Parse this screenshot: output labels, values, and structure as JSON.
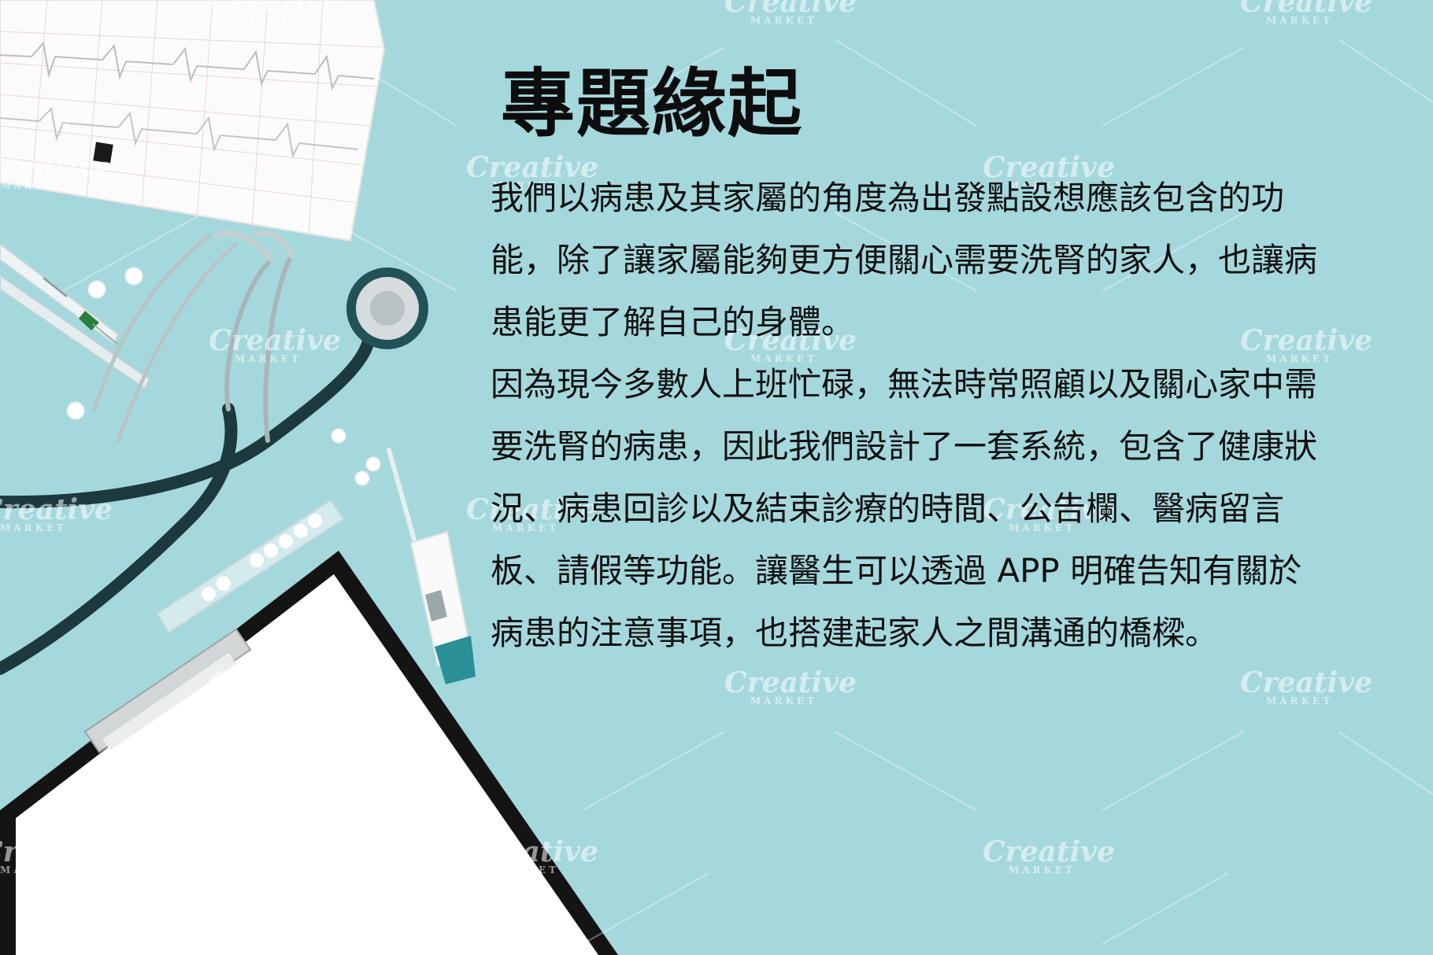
{
  "slide": {
    "title": "專題緣起",
    "lines": [
      " 我們以病患及其家屬的角度為出發點設想應該包含的功",
      "能，除了讓家屬能夠更方便關心需要洗腎的家人，也讓病",
      "患能更了解自己的身體。",
      "因為現今多數人上班忙碌，無法時常照顧以及關心家中需",
      "要洗腎的病患，因此我們設計了一套系統，包含了健康狀",
      "況、病患回診以及結束診療的時間、公告欄、醫病留言",
      "板、請假等功能。讓醫生可以透過 APP 明確告知有關於",
      "病患的注意事項，也搭建起家人之間溝通的橋樑。"
    ]
  },
  "watermark": {
    "brand": "Creative",
    "sub": "MARKET"
  },
  "colors": {
    "background": "#a5d8dd",
    "text": "#111111",
    "stethoscope": "#1c3a3e",
    "accent": "#2a8f97"
  }
}
